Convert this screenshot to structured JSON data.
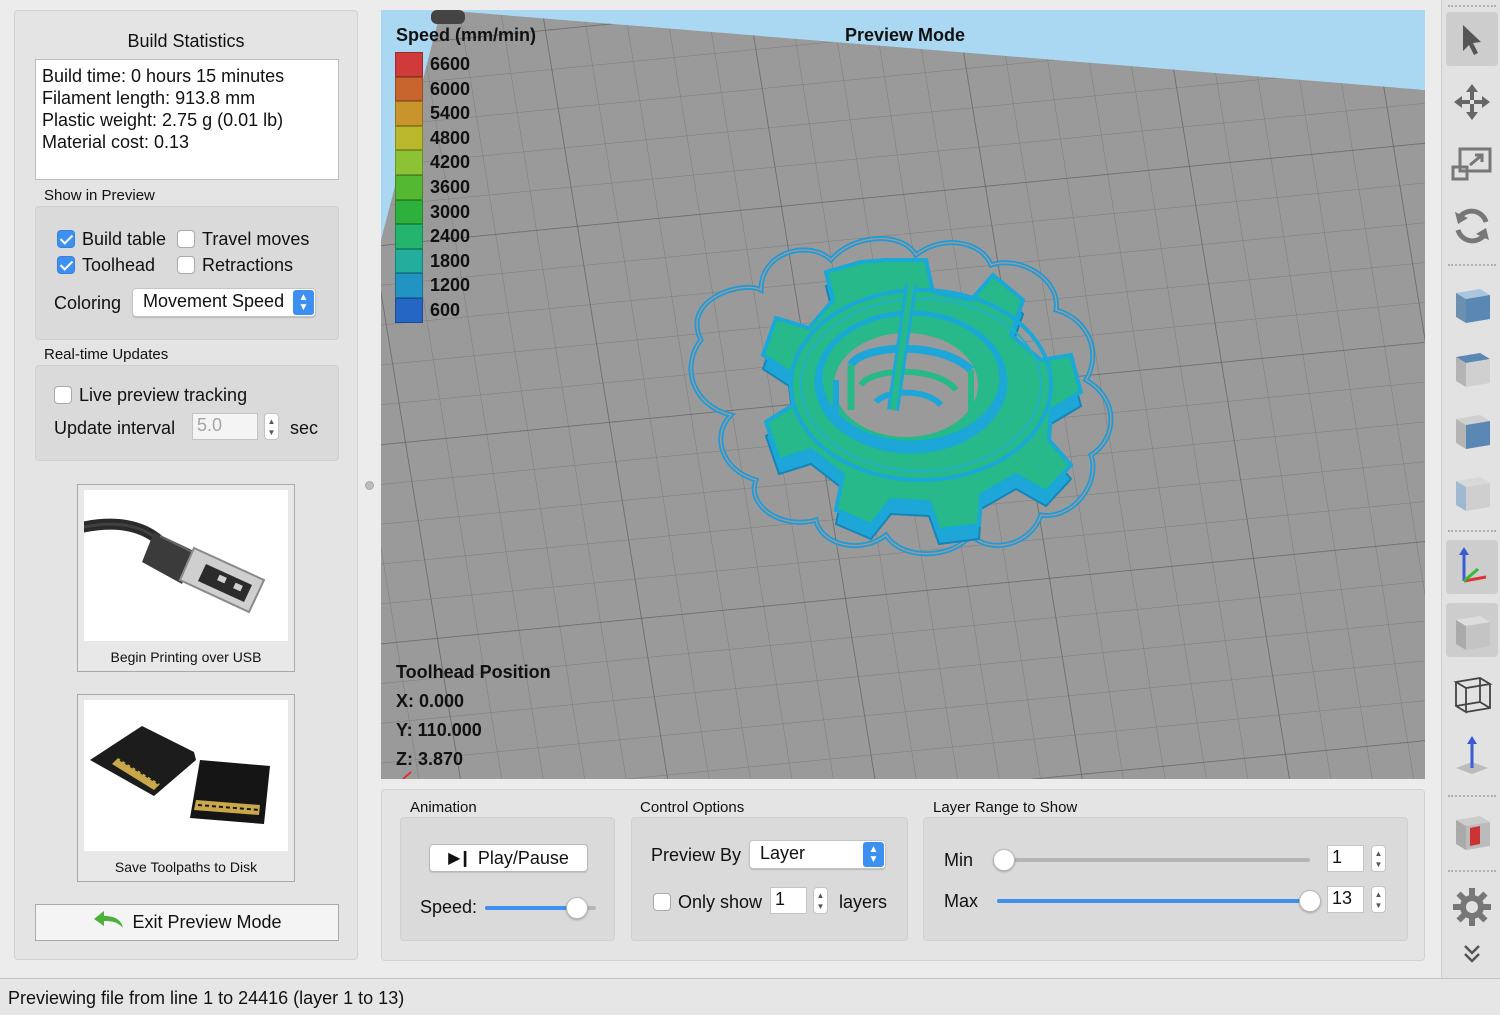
{
  "build_statistics": {
    "title": "Build Statistics",
    "lines": [
      "Build time: 0 hours 15 minutes",
      "Filament length: 913.8 mm",
      "Plastic weight: 2.75 g (0.01 lb)",
      "Material cost: 0.13"
    ]
  },
  "show_in_preview": {
    "title": "Show in Preview",
    "build_table": {
      "label": "Build table",
      "checked": true
    },
    "travel_moves": {
      "label": "Travel moves",
      "checked": false
    },
    "toolhead": {
      "label": "Toolhead",
      "checked": true
    },
    "retractions": {
      "label": "Retractions",
      "checked": false
    },
    "coloring_label": "Coloring",
    "coloring_value": "Movement Speed"
  },
  "realtime_updates": {
    "title": "Real-time Updates",
    "live_tracking": {
      "label": "Live preview tracking",
      "checked": false
    },
    "interval_label": "Update interval",
    "interval_value": "5.0",
    "interval_unit": "sec"
  },
  "actions": {
    "usb_label": "Begin Printing over USB",
    "disk_label": "Save Toolpaths to Disk",
    "exit_label": "Exit Preview Mode"
  },
  "viewport": {
    "mode_title": "Preview Mode",
    "legend_title": "Speed (mm/min)",
    "legend": [
      {
        "value": "6600",
        "color": "#d03a3a"
      },
      {
        "value": "6000",
        "color": "#c8652f"
      },
      {
        "value": "5400",
        "color": "#c7952c"
      },
      {
        "value": "4800",
        "color": "#b9b82d"
      },
      {
        "value": "4200",
        "color": "#8cc234"
      },
      {
        "value": "3600",
        "color": "#55b833"
      },
      {
        "value": "3000",
        "color": "#2eb03c"
      },
      {
        "value": "2400",
        "color": "#24b46e"
      },
      {
        "value": "1800",
        "color": "#22ad9c"
      },
      {
        "value": "1200",
        "color": "#2294c4"
      },
      {
        "value": "600",
        "color": "#2565c4"
      }
    ],
    "toolhead_title": "Toolhead Position",
    "toolhead_x": "X: 0.000",
    "toolhead_y": "Y: 110.000",
    "toolhead_z": "Z: 3.870"
  },
  "animation": {
    "title": "Animation",
    "play_label": "Play/Pause",
    "speed_label": "Speed:",
    "speed_fraction": 0.83
  },
  "control_options": {
    "title": "Control Options",
    "preview_by_label": "Preview By",
    "preview_by_value": "Layer",
    "only_show": {
      "label": "Only show",
      "checked": false
    },
    "only_show_value": "1",
    "layers_label": "layers"
  },
  "layer_range": {
    "title": "Layer Range to Show",
    "min_label": "Min",
    "min_value": "1",
    "max_label": "Max",
    "max_value": "13",
    "total_layers": 13
  },
  "toolbar": {
    "tools": [
      "select-arrow-icon",
      "move-icon",
      "scale-icon",
      "rotate-icon",
      "view-iso-icon",
      "view-front-icon",
      "view-side-icon",
      "view-top-icon",
      "axes-icon",
      "solid-view-icon",
      "wireframe-icon",
      "z-axis-icon",
      "section-view-icon",
      "gear-icon",
      "chevron-down-icon"
    ]
  },
  "status_bar": {
    "text": "Previewing file from line 1 to 24416 (layer 1 to 13)"
  }
}
